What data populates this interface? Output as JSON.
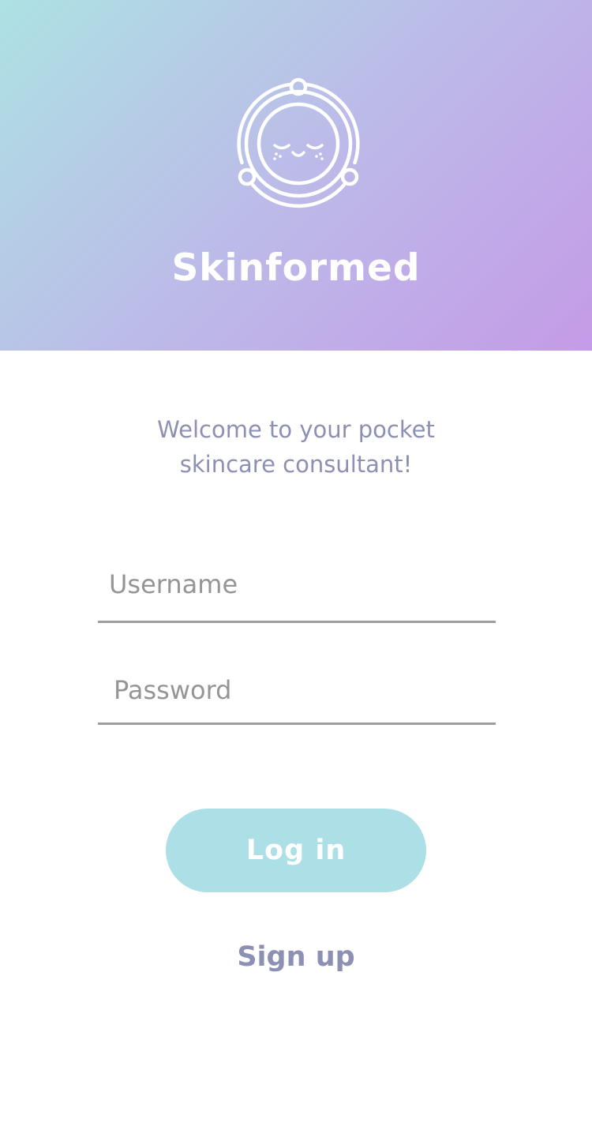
{
  "app": {
    "title": "Skinformed",
    "logo_icon": "smiling-face-orbit-icon"
  },
  "welcome": {
    "line1": "Welcome to your pocket",
    "line2": "skincare consultant!"
  },
  "form": {
    "username_placeholder": "Username",
    "username_value": "",
    "password_placeholder": "Password",
    "password_value": ""
  },
  "actions": {
    "login_label": "Log in",
    "signup_label": "Sign up"
  },
  "colors": {
    "header_gradient_start": "#ade2e3",
    "header_gradient_end": "#c49be7",
    "login_button": "#ade0e6",
    "accent_text": "#8c90b3"
  }
}
